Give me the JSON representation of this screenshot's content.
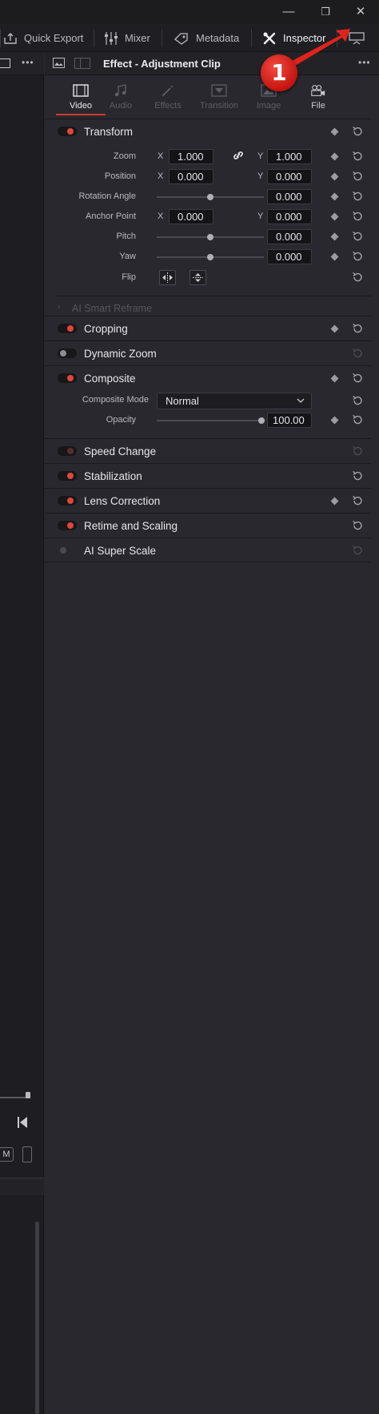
{
  "window": {
    "minimize": "—",
    "restore": "❐",
    "close": "✕"
  },
  "toolbar": {
    "items": [
      {
        "label": "Quick Export",
        "icon": "export-icon"
      },
      {
        "label": "Mixer",
        "icon": "mixer-icon"
      },
      {
        "label": "Metadata",
        "icon": "metadata-tag-icon"
      },
      {
        "label": "Inspector",
        "icon": "inspector-icon",
        "active": true
      }
    ],
    "panel_toggle_icon": "panel-toggle-icon"
  },
  "annotation": {
    "badge": "1",
    "color": "#e0231b"
  },
  "inspector": {
    "title": "Effect - Adjustment Clip",
    "more": "•••",
    "tabs": [
      {
        "label": "Video",
        "active": true
      },
      {
        "label": "Audio"
      },
      {
        "label": "Effects"
      },
      {
        "label": "Transition"
      },
      {
        "label": "Image"
      },
      {
        "label": "File"
      }
    ],
    "transform": {
      "title": "Transform",
      "zoom_label": "Zoom",
      "zoom_x": "1.000",
      "zoom_y": "1.000",
      "position_label": "Position",
      "position_x": "0.000",
      "position_y": "0.000",
      "rotation_label": "Rotation Angle",
      "rotation_value": "0.000",
      "anchor_label": "Anchor Point",
      "anchor_x": "0.000",
      "anchor_y": "0.000",
      "pitch_label": "Pitch",
      "pitch_value": "0.000",
      "yaw_label": "Yaw",
      "yaw_value": "0.000",
      "flip_label": "Flip",
      "x": "X",
      "y": "Y"
    },
    "smart_reframe": "AI Smart Reframe",
    "cropping": "Cropping",
    "dynamic_zoom": "Dynamic Zoom",
    "composite": {
      "title": "Composite",
      "mode_label": "Composite Mode",
      "mode_value": "Normal",
      "opacity_label": "Opacity",
      "opacity_value": "100.00"
    },
    "speed_change": "Speed Change",
    "stabilization": "Stabilization",
    "lens_correction": "Lens Correction",
    "retime": "Retime and Scaling",
    "super_scale": "AI Super Scale"
  },
  "left_pane": {
    "more": "•••",
    "m_label": "M"
  },
  "colors": {
    "accent": "#e1453a",
    "background": "#28282e",
    "toolbar": "#1f1f23"
  }
}
